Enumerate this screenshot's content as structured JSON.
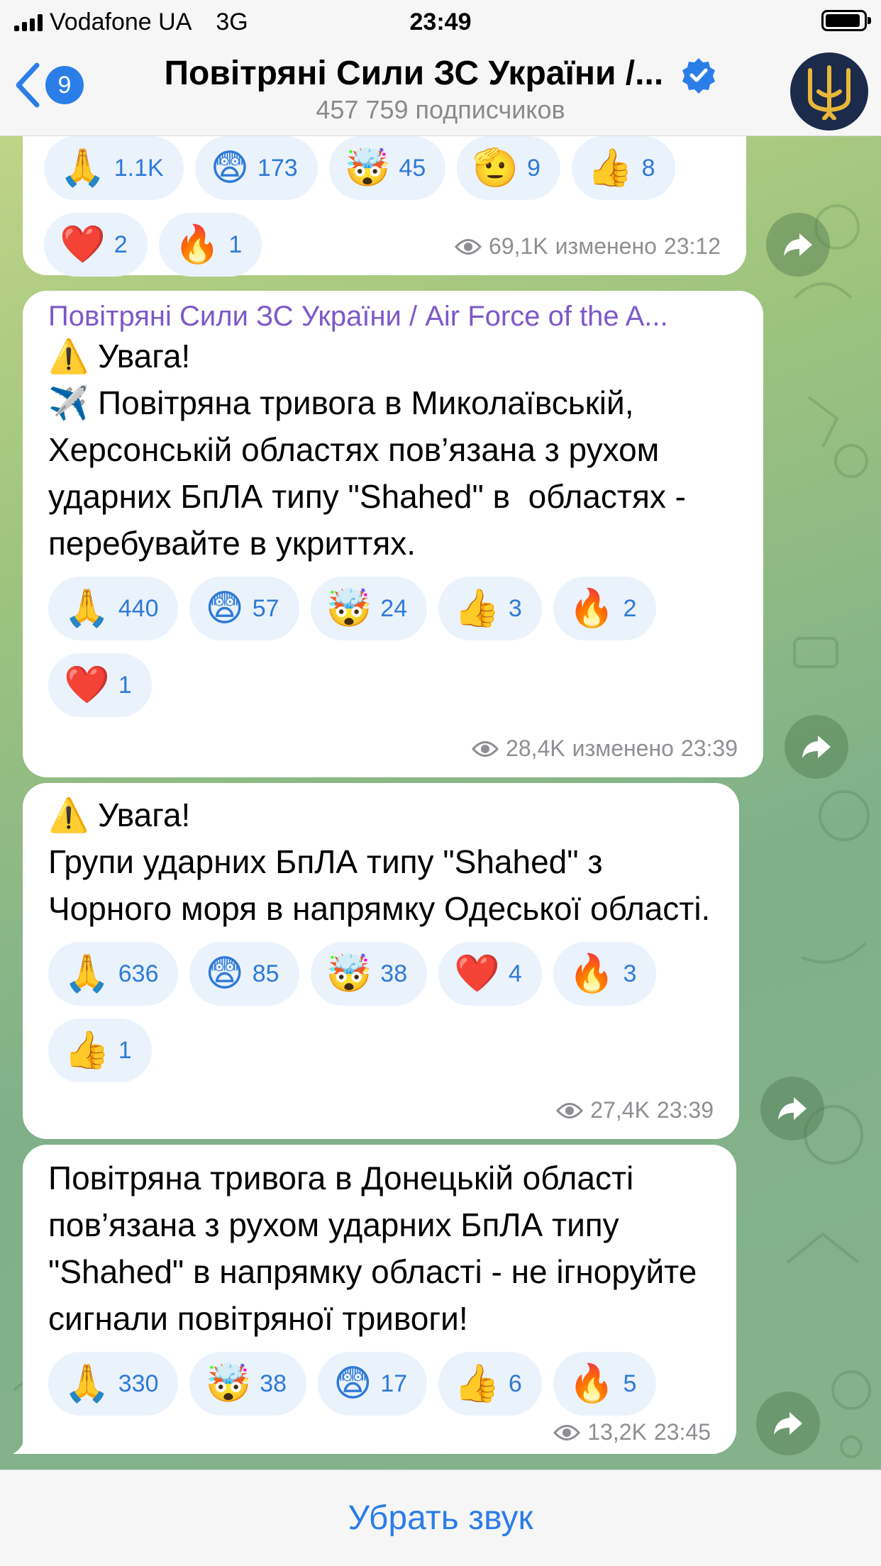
{
  "status_bar": {
    "carrier": "Vodafone UA",
    "network": "3G",
    "time": "23:49"
  },
  "header": {
    "back_count": "9",
    "title": "Повітряні Сили ЗС України /...",
    "subscribers": "457 759 подписчиков"
  },
  "messages": [
    {
      "reactions": [
        {
          "emoji": "🙏",
          "count": "1.1K"
        },
        {
          "emoji": "😨",
          "count": "173"
        },
        {
          "emoji": "🤯",
          "count": "45"
        },
        {
          "emoji": "🫡",
          "count": "9"
        },
        {
          "emoji": "👍",
          "count": "8"
        },
        {
          "emoji": "❤️",
          "count": "2"
        },
        {
          "emoji": "🔥",
          "count": "1"
        }
      ],
      "views": "69,1K",
      "edited": "изменено",
      "time": "23:12"
    },
    {
      "sender": "Повітряні Сили ЗС України / Air Force of the A...",
      "text": "⚠️ Увага!\n✈️ Повітряна тривога в Миколаївській, Херсонській областях пов’язана з рухом ударних БпЛА типу \"Shahed\" в  областях -\nперебувайте в укриттях.",
      "reactions": [
        {
          "emoji": "🙏",
          "count": "440"
        },
        {
          "emoji": "😨",
          "count": "57"
        },
        {
          "emoji": "🤯",
          "count": "24"
        },
        {
          "emoji": "👍",
          "count": "3"
        },
        {
          "emoji": "🔥",
          "count": "2"
        },
        {
          "emoji": "❤️",
          "count": "1"
        }
      ],
      "views": "28,4K",
      "edited": "изменено",
      "time": "23:39"
    },
    {
      "text": "⚠️ Увага!\nГрупи ударних БпЛА типу \"Shahed\" з Чорного моря в напрямку Одеської області.",
      "reactions": [
        {
          "emoji": "🙏",
          "count": "636"
        },
        {
          "emoji": "😨",
          "count": "85"
        },
        {
          "emoji": "🤯",
          "count": "38"
        },
        {
          "emoji": "❤️",
          "count": "4"
        },
        {
          "emoji": "🔥",
          "count": "3"
        },
        {
          "emoji": "👍",
          "count": "1"
        }
      ],
      "views": "27,4K",
      "time": "23:39"
    },
    {
      "text": "Повітряна тривога в Донецькій області пов’язана з рухом ударних БпЛА типу \"Shahed\" в напрямку області - не ігноруйте сигнали повітряної тривоги!",
      "reactions": [
        {
          "emoji": "🙏",
          "count": "330"
        },
        {
          "emoji": "🤯",
          "count": "38"
        },
        {
          "emoji": "😨",
          "count": "17"
        },
        {
          "emoji": "👍",
          "count": "6"
        },
        {
          "emoji": "🔥",
          "count": "5"
        }
      ],
      "views": "13,2K",
      "time": "23:45"
    }
  ],
  "bottom_bar": {
    "mute_label": "Убрать звук"
  },
  "colors": {
    "accent": "#2b7ee8",
    "sender": "#7d58c8",
    "reaction_bg": "#eaf2fb"
  }
}
